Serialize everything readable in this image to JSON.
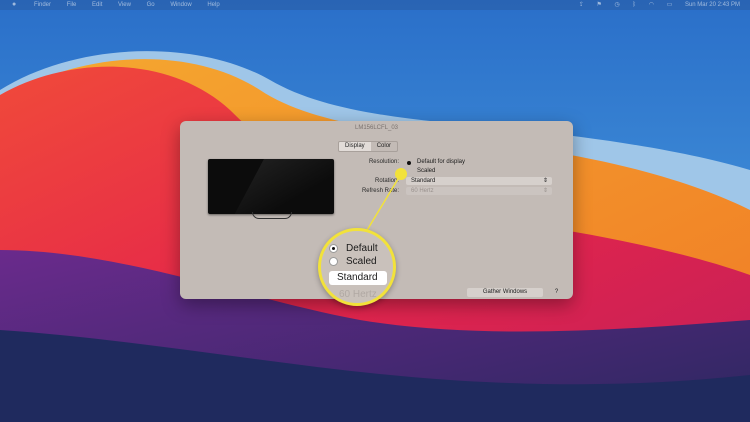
{
  "menubar": {
    "apple_icon": "apple-logo",
    "menus": [
      "Finder",
      "File",
      "Edit",
      "View",
      "Go",
      "Window",
      "Help"
    ],
    "status_icons": [
      "upload-icon",
      "vpn-icon",
      "time-machine-icon",
      "bluetooth-icon",
      "wifi-icon",
      "battery-icon"
    ],
    "datetime": "Sun Mar 20  2:43 PM"
  },
  "window": {
    "title": "LM156LCFL_03",
    "tabs": [
      {
        "label": "Display",
        "active": true
      },
      {
        "label": "Color",
        "active": false
      }
    ],
    "resolution_label": "Resolution:",
    "resolution_options": [
      {
        "label": "Default for display",
        "selected": true
      },
      {
        "label": "Scaled",
        "selected": false
      }
    ],
    "rotation_label": "Rotation:",
    "rotation_value": "Standard",
    "refresh_label": "Refresh Rate:",
    "refresh_value": "60 Hertz",
    "gather_button": "Gather Windows",
    "help_button": "?"
  },
  "magnifier": {
    "option1": "Default",
    "option2": "Scaled",
    "rotation": "Standard",
    "refresh": "60 Hertz"
  },
  "colors": {
    "callout": "#f2e23a",
    "window_bg": "#c3bbb6"
  }
}
